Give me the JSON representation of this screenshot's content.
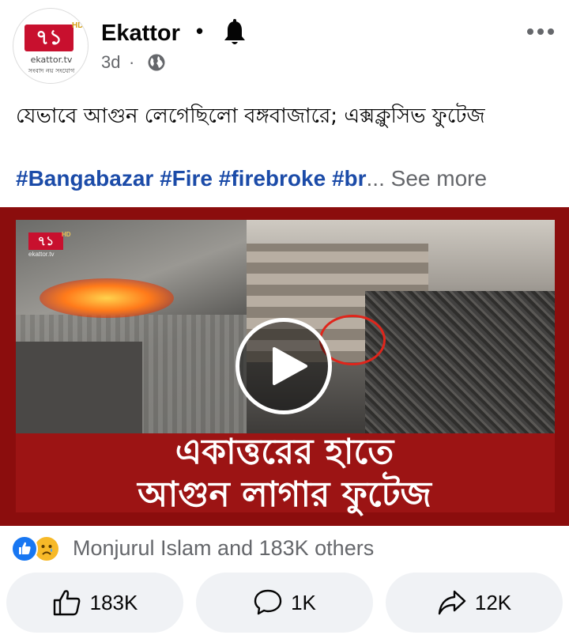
{
  "post": {
    "page_name": "Ekattor",
    "separator": "•",
    "time": "3d",
    "time_separator": "·",
    "avatar": {
      "logo_text": "৭১",
      "hd": "HD",
      "site": "ekattor.tv",
      "tagline": "সংবাদ নয় সংযোগ"
    },
    "text": "যেভাবে আগুন লেগেছিলো বঙ্গবাজারে; এক্সক্লুসিভ ফুটেজ",
    "hashtags": "#Bangabazar #Fire #firebroke  #br",
    "ellipsis": "...",
    "see_more": "See more",
    "icons": {
      "bell": "bell-icon",
      "globe": "globe-icon",
      "more": "more-options-icon"
    }
  },
  "video": {
    "watermark_logo": "৭১",
    "watermark_hd": "HD",
    "watermark_site": "ekattor.tv",
    "caption_line1": "একাত্তরের হাতে",
    "caption_line2": "আগুন লাগার ফুটেজ",
    "play_icon": "play-icon"
  },
  "reactions": {
    "summary": "Monjurul Islam and 183K others",
    "types": [
      "like",
      "sad"
    ]
  },
  "actions": {
    "like_count": "183K",
    "comment_count": "1K",
    "share_count": "12K"
  },
  "colors": {
    "hashtag": "#1b4ba8",
    "brand_red": "#c8102e",
    "like_blue": "#1877f2",
    "button_bg": "#f0f2f5",
    "secondary_text": "#65676b"
  }
}
